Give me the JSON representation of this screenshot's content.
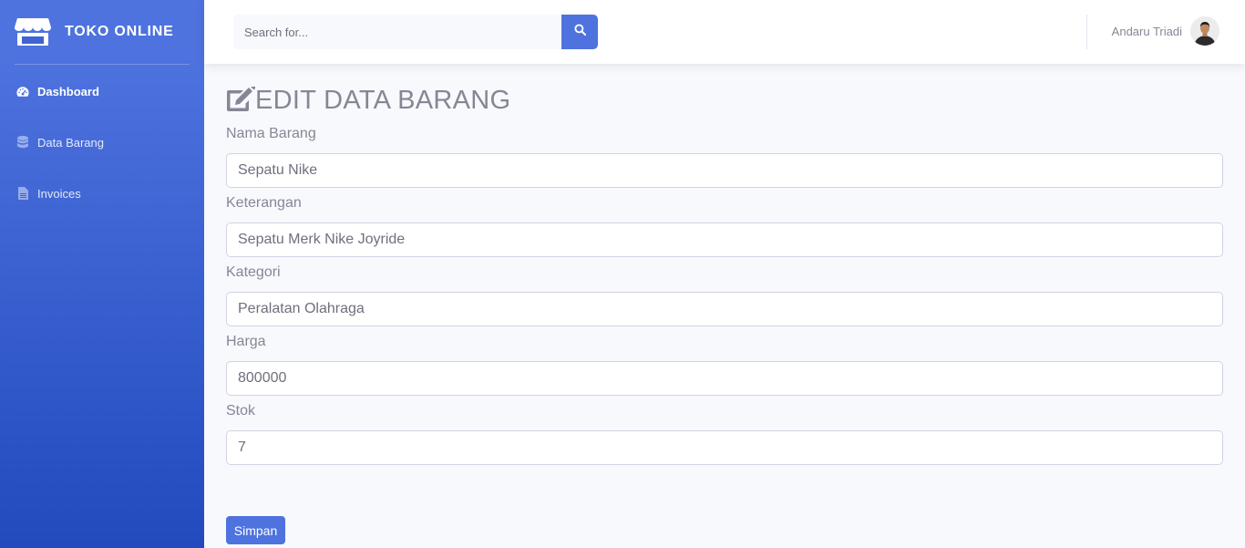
{
  "brand": {
    "name": "TOKO ONLINE"
  },
  "sidebar": {
    "items": [
      {
        "label": "Dashboard",
        "icon": "tachometer-icon",
        "active": true
      },
      {
        "label": "Data Barang",
        "icon": "database-icon",
        "active": false
      },
      {
        "label": "Invoices",
        "icon": "file-icon",
        "active": false
      }
    ]
  },
  "topbar": {
    "search_placeholder": "Search for...",
    "user_name": "Andaru Triadi"
  },
  "page": {
    "title": "EDIT DATA BARANG"
  },
  "form": {
    "fields": [
      {
        "label": "Nama Barang",
        "value": "Sepatu Nike"
      },
      {
        "label": "Keterangan",
        "value": "Sepatu Merk Nike Joyride"
      },
      {
        "label": "Kategori",
        "value": "Peralatan Olahraga"
      },
      {
        "label": "Harga",
        "value": "800000"
      },
      {
        "label": "Stok",
        "value": "7"
      }
    ],
    "submit_label": "Simpan"
  },
  "colors": {
    "primary": "#4e73df",
    "primary_dark": "#224abe",
    "text": "#858796"
  }
}
